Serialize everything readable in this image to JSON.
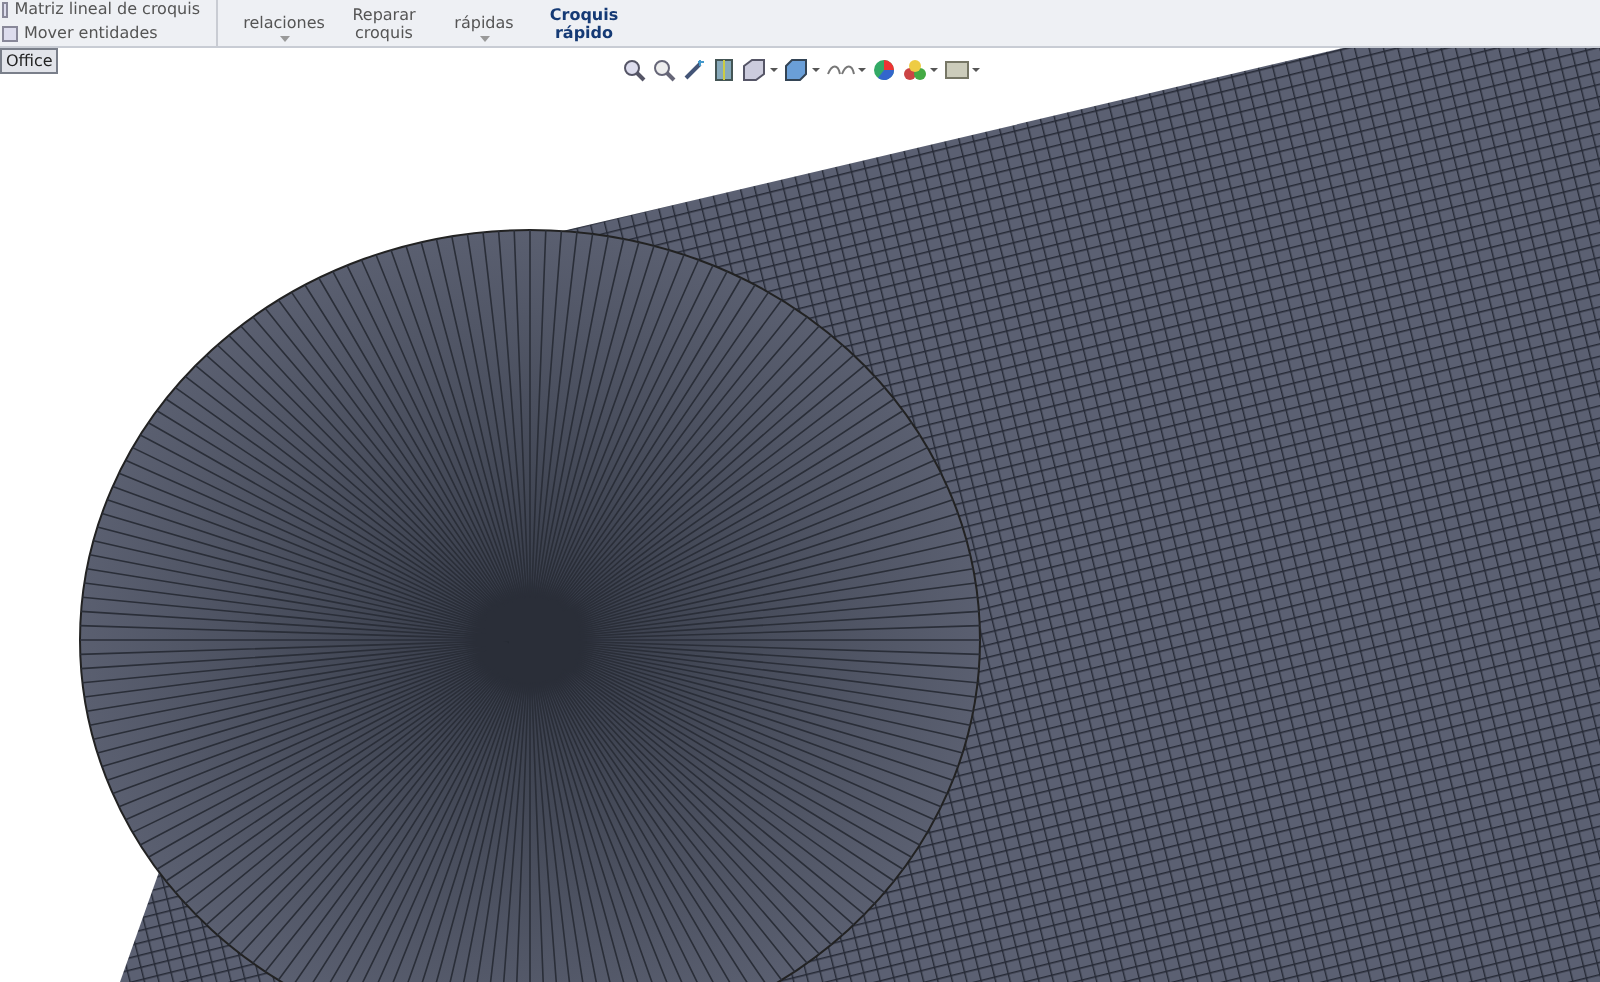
{
  "ribbon": {
    "left_items": [
      {
        "label": "Matriz lineal de croquis"
      },
      {
        "label": "Mover entidades"
      }
    ],
    "groups": [
      {
        "label": "relaciones",
        "caret": true,
        "highlighted": false
      },
      {
        "label": "Reparar croquis",
        "caret": false,
        "highlighted": false
      },
      {
        "label": "rápidas",
        "caret": true,
        "highlighted": false
      },
      {
        "label": "Croquis rápido",
        "caret": false,
        "highlighted": true
      }
    ]
  },
  "tab": {
    "label": "Office"
  }
}
